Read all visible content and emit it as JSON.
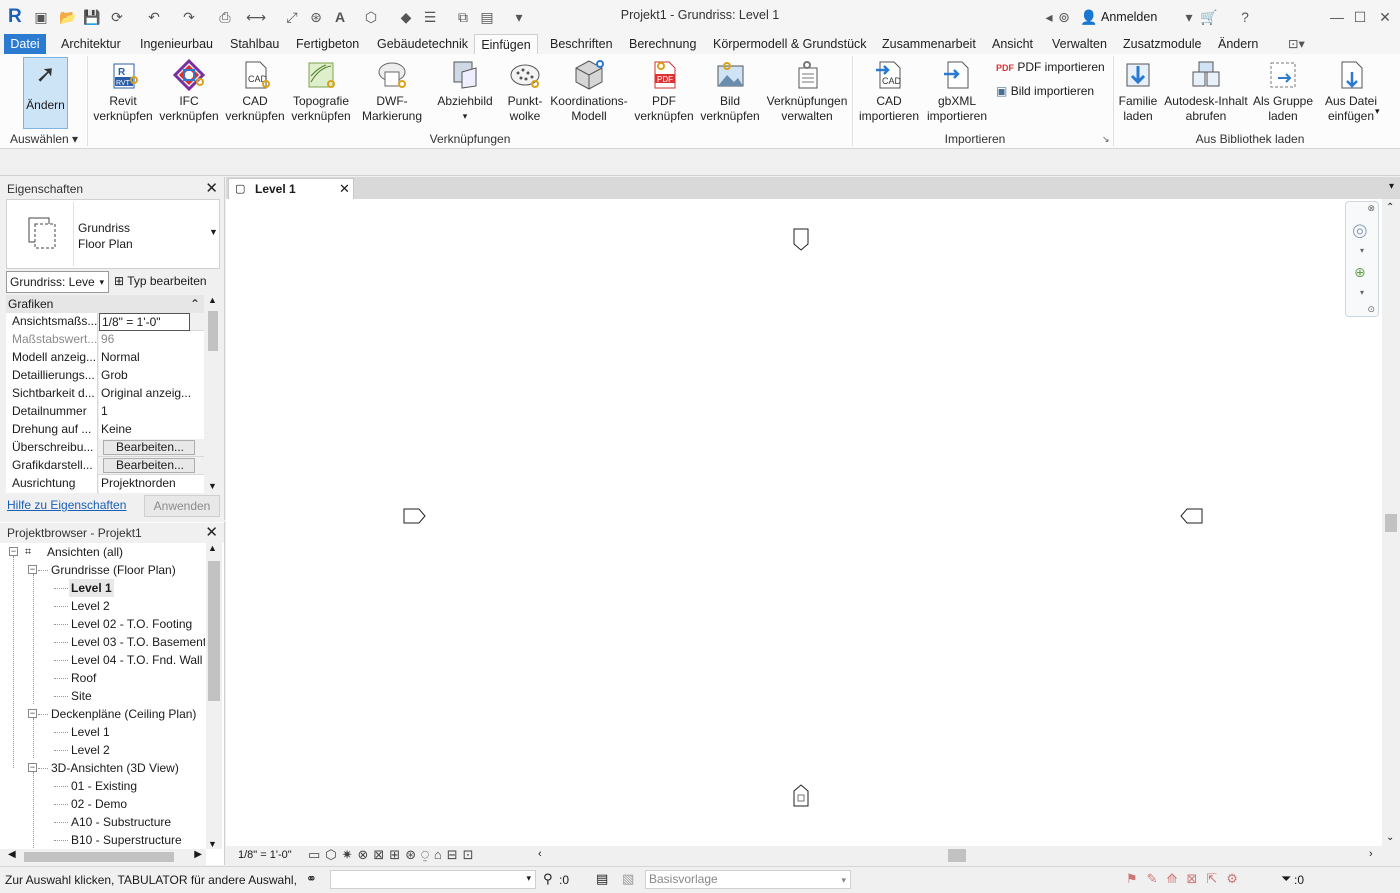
{
  "window_title": "Projekt1 - Grundriss: Level 1",
  "app_logo": "R",
  "signin": {
    "label": "Anmelden"
  },
  "menu": [
    "Datei",
    "Architektur",
    "Ingenieurbau",
    "Stahlbau",
    "Fertigbeton",
    "Gebäudetechnik",
    "Einfügen",
    "Beschriften",
    "Berechnung",
    "Körpermodell & Grundstück",
    "Zusammenarbeit",
    "Ansicht",
    "Verwalten",
    "Zusatzmodule",
    "Ändern"
  ],
  "ribbon": {
    "modify": {
      "label": "Ändern",
      "group": "Auswählen"
    },
    "links_group": "Verknüpfungen",
    "import_group": "Importieren",
    "library_group": "Aus Bibliothek laden",
    "buttons": [
      {
        "l1": "Revit",
        "l2": "verknüpfen",
        "icon": "revit-link-icon"
      },
      {
        "l1": "IFC",
        "l2": "verknüpfen",
        "icon": "ifc-link-icon"
      },
      {
        "l1": "CAD",
        "l2": "verknüpfen",
        "icon": "cad-link-icon"
      },
      {
        "l1": "Topografie",
        "l2": "verknüpfen",
        "icon": "topography-link-icon"
      },
      {
        "l1": "DWF-",
        "l2": "Markierung",
        "icon": "dwf-markup-icon"
      },
      {
        "l1": "Abziehbild",
        "l2": "",
        "icon": "decal-icon"
      },
      {
        "l1": "Punkt-",
        "l2": "wolke",
        "icon": "point-cloud-icon"
      },
      {
        "l1": "Koordinations-",
        "l2": "Modell",
        "icon": "coordination-model-icon"
      },
      {
        "l1": "PDF",
        "l2": "verknüpfen",
        "icon": "pdf-link-icon"
      },
      {
        "l1": "Bild",
        "l2": "verknüpfen",
        "icon": "image-link-icon"
      },
      {
        "l1": "Verknüpfungen",
        "l2": "verwalten",
        "icon": "manage-links-icon"
      },
      {
        "l1": "CAD",
        "l2": "importieren",
        "icon": "cad-import-icon"
      },
      {
        "l1": "gbXML",
        "l2": "importieren",
        "icon": "gbxml-import-icon"
      },
      {
        "l1": "Familie",
        "l2": "laden",
        "icon": "load-family-icon"
      },
      {
        "l1": "Autodesk-Inhalt",
        "l2": "abrufen",
        "icon": "autodesk-content-icon"
      },
      {
        "l1": "Als Gruppe",
        "l2": "laden",
        "icon": "load-as-group-icon"
      },
      {
        "l1": "Aus Datei",
        "l2": "einfügen",
        "icon": "insert-from-file-icon"
      }
    ],
    "small": {
      "pdf": "PDF  importieren",
      "image": "Bild  importieren"
    }
  },
  "properties": {
    "title": "Eigenschaften",
    "type_l1": "Grundriss",
    "type_l2": "Floor Plan",
    "selector": "Grundriss: Leve",
    "edit_type": "Typ bearbeiten",
    "section": "Grafiken",
    "rows": [
      {
        "k": "Ansichtsmaßs...",
        "v": "1/8\" = 1'-0\""
      },
      {
        "k": "Maßstabswert...",
        "v": "96"
      },
      {
        "k": "Modell anzeig...",
        "v": "Normal"
      },
      {
        "k": "Detaillierungs...",
        "v": "Grob"
      },
      {
        "k": "Sichtbarkeit d...",
        "v": "Original anzeig..."
      },
      {
        "k": "Detailnummer",
        "v": "1"
      },
      {
        "k": "Drehung auf ...",
        "v": "Keine"
      },
      {
        "k": "Überschreibu...",
        "v": "Bearbeiten..."
      },
      {
        "k": "Grafikdarstell...",
        "v": "Bearbeiten..."
      },
      {
        "k": "Ausrichtung",
        "v": "Projektnorden"
      }
    ],
    "help": "Hilfe zu Eigenschaften",
    "apply": "Anwenden"
  },
  "browser": {
    "title": "Projektbrowser - Projekt1",
    "items": [
      {
        "t": "Ansichten (all)",
        "lvl": 0
      },
      {
        "t": "Grundrisse (Floor Plan)",
        "lvl": 1
      },
      {
        "t": "Level 1",
        "lvl": 2
      },
      {
        "t": "Level 2",
        "lvl": 2
      },
      {
        "t": "Level 02 - T.O. Footing",
        "lvl": 2
      },
      {
        "t": "Level 03 - T.O. Basement",
        "lvl": 2
      },
      {
        "t": "Level 04 - T.O. Fnd. Wall",
        "lvl": 2
      },
      {
        "t": "Roof",
        "lvl": 2
      },
      {
        "t": "Site",
        "lvl": 2
      },
      {
        "t": "Deckenpläne (Ceiling Plan)",
        "lvl": 1
      },
      {
        "t": "Level 1",
        "lvl": 2
      },
      {
        "t": "Level 2",
        "lvl": 2
      },
      {
        "t": "3D-Ansichten (3D View)",
        "lvl": 1
      },
      {
        "t": "01 - Existing",
        "lvl": 2
      },
      {
        "t": "02 - Demo",
        "lvl": 2
      },
      {
        "t": "A10 - Substructure",
        "lvl": 2
      },
      {
        "t": "B10 - Superstructure",
        "lvl": 2
      }
    ]
  },
  "view_tab": "Level 1",
  "scale": "1/8\" = 1'-0\"",
  "status": {
    "hint": "Zur Auswahl klicken, TABULATOR für andere Auswahl, S",
    "sel_count": ":0",
    "workset": "Basisvorlage",
    "filter_count": ":0"
  },
  "colors": {
    "accent": "#2b7bd1",
    "panel": "#f0f0f0",
    "canvas": "#ffffff"
  }
}
